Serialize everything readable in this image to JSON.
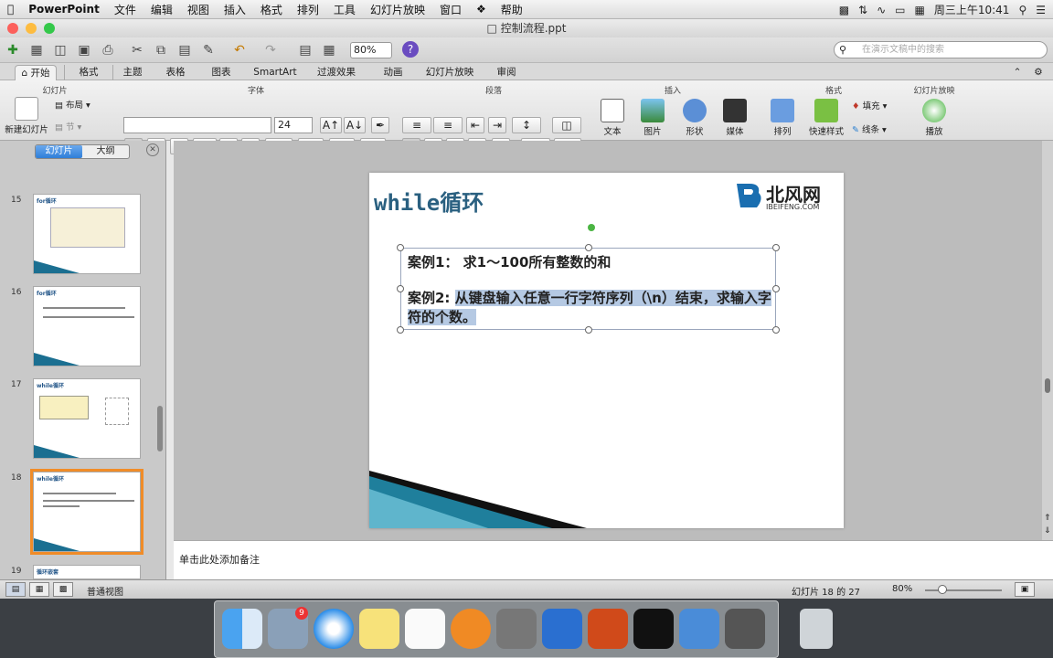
{
  "menubar": {
    "app": "PowerPoint",
    "items": [
      "文件",
      "编辑",
      "视图",
      "插入",
      "格式",
      "排列",
      "工具",
      "幻灯片放映",
      "窗口",
      "帮助"
    ],
    "clock": "周三上午10:41"
  },
  "window": {
    "title": "控制流程.ppt"
  },
  "toolbar": {
    "zoom": "80%",
    "search_placeholder": "在演示文稿中的搜索"
  },
  "ribbon_tabs": [
    "开始",
    "格式",
    "主题",
    "表格",
    "图表",
    "SmartArt",
    "过渡效果",
    "动画",
    "幻灯片放映",
    "审阅"
  ],
  "ribbon": {
    "groups": [
      "幻灯片",
      "字体",
      "段落",
      "插入",
      "格式",
      "幻灯片放映"
    ],
    "new_slide": "新建幻灯片",
    "layout": "布局",
    "section": "节",
    "font_size": "24",
    "insert_items": [
      "文本",
      "图片",
      "形状",
      "媒体"
    ],
    "format_items": [
      "排列",
      "快速样式"
    ],
    "fill": "填充",
    "line": "线条",
    "play": "播放"
  },
  "left_panel": {
    "tabs": [
      "幻灯片",
      "大纲"
    ],
    "thumbs": [
      {
        "num": "15",
        "title": "for循环"
      },
      {
        "num": "16",
        "title": "for循环"
      },
      {
        "num": "17",
        "title": "while循环"
      },
      {
        "num": "18",
        "title": "while循环"
      },
      {
        "num": "19",
        "title": "循环嵌套"
      }
    ]
  },
  "slide": {
    "title": "while循环",
    "logo_text": "北风网",
    "logo_sub": "IBEIFENG.COM",
    "case1": "案例1：  求1～100所有整数的和",
    "case2_label": "案例2: ",
    "case2_text": "从键盘输入任意一行字符序列（\\n）结束，求输入字符的个数。"
  },
  "notes": {
    "placeholder": "单击此处添加备注"
  },
  "status": {
    "view": "普通视图",
    "slide_counter": "幻灯片 18 的 27",
    "zoom": "80%"
  },
  "dock": {
    "mail_badge": "9"
  }
}
